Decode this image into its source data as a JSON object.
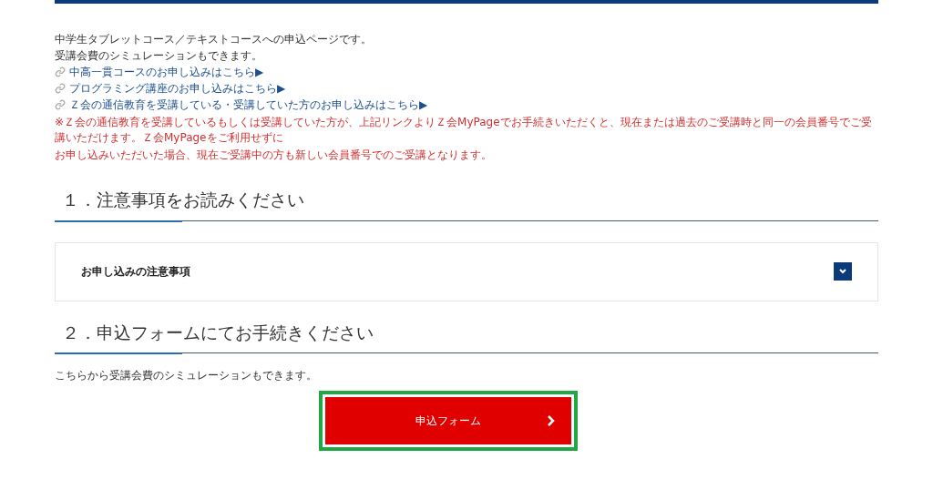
{
  "intro": [
    "中学生タブレットコース／テキストコースへの申込ページです。",
    "受講会費のシミュレーションもできます。"
  ],
  "links": [
    {
      "label": "中高一貫コースのお申し込みはこちら▶"
    },
    {
      "label": "プログラミング講座のお申し込みはこちら▶"
    },
    {
      "label": "Ｚ会の通信教育を受講している・受講していた方のお申し込みはこちら▶"
    }
  ],
  "notice": [
    "※Ｚ会の通信教育を受講しているもしくは受講していた方が、上記リンクよりＺ会MyPageでお手続きいただくと、現在または過去のご受講時と同一の会員番号でご受講いただけます。Ｚ会MyPageをご利用せずに",
    "お申し込みいただいた場合、現在ご受講中の方も新しい会員番号でのご受講となります。"
  ],
  "sections": [
    {
      "heading": "１．注意事項をお読みください",
      "accordion": {
        "title": "お申し込みの注意事項",
        "expanded": false
      }
    },
    {
      "heading": "２．申込フォームにてお手続きください",
      "text": "こちらから受講会費のシミュレーションもできます。",
      "button": {
        "label": "申込フォーム"
      }
    }
  ]
}
